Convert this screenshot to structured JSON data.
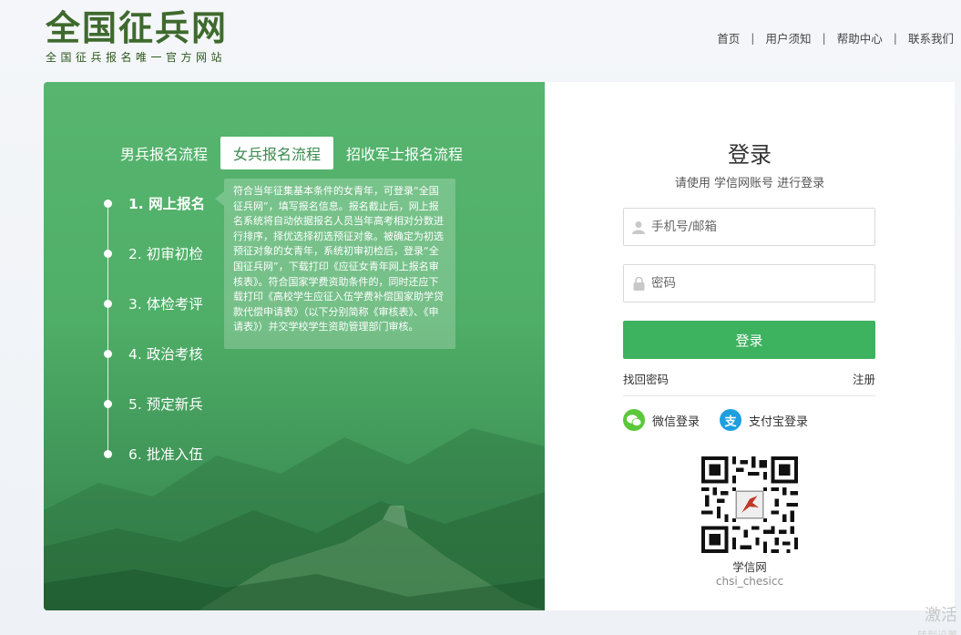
{
  "header": {
    "logo_title": "全国征兵网",
    "logo_subtitle": "全国征兵报名唯一官方网站",
    "nav": [
      "首页",
      "用户须知",
      "帮助中心",
      "联系我们"
    ]
  },
  "left": {
    "tabs": [
      "男兵报名流程",
      "女兵报名流程",
      "招收军士报名流程"
    ],
    "active_tab": 1,
    "steps": [
      "1. 网上报名",
      "2. 初审初检",
      "3. 体检考评",
      "4. 政治考核",
      "5. 预定新兵",
      "6. 批准入伍"
    ],
    "active_step": 0,
    "tip": "符合当年征集基本条件的女青年，可登录“全国征兵网”，填写报名信息。报名截止后，网上报名系统将自动依据报名人员当年高考相对分数进行排序，择优选择初选预征对象。被确定为初选预征对象的女青年，系统初审初检后，登录“全国征兵网”，下载打印《应征女青年网上报名审核表》。符合国家学费资助条件的，同时还应下载打印《高校学生应征入伍学费补偿国家助学贷款代偿申请表》（以下分别简称《审核表》、《申请表》）并交学校学生资助管理部门审核。"
  },
  "login": {
    "title": "登录",
    "subtitle": "请使用 学信网账号 进行登录",
    "username_placeholder": "手机号/邮箱",
    "password_placeholder": "密码",
    "button": "登录",
    "forgot": "找回密码",
    "register": "注册",
    "wechat": "微信登录",
    "alipay": "支付宝登录",
    "qr_label": "学信网",
    "qr_sub": "chsi_chesicc"
  },
  "watermark": "激活",
  "watermark2": "转到设置",
  "colors": {
    "brand_green": "#3db25f",
    "logo_green": "#3f6a2e",
    "wechat": "#5ac83a",
    "alipay": "#1d9fe0"
  }
}
